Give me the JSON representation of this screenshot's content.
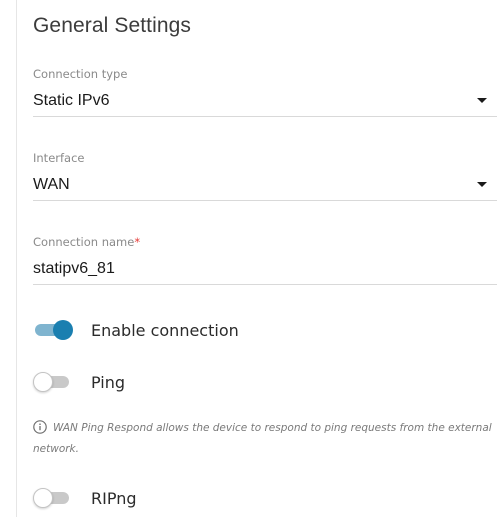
{
  "section": {
    "title": "General Settings"
  },
  "connection_type": {
    "label": "Connection type",
    "value": "Static IPv6"
  },
  "interface": {
    "label": "Interface",
    "value": "WAN"
  },
  "connection_name": {
    "label": "Connection name",
    "required_mark": "*",
    "value": "statipv6_81"
  },
  "toggles": {
    "enable_connection": {
      "label": "Enable connection",
      "state": "on"
    },
    "ping": {
      "label": "Ping",
      "state": "off"
    },
    "ripng": {
      "label": "RIPng",
      "state": "off"
    }
  },
  "ping_hint": {
    "icon": "info-icon",
    "text": "WAN Ping Respond allows the device to respond to ping requests from the external network."
  },
  "colors": {
    "accent": "#1a7fb0",
    "accent_track": "#7fb4cf",
    "required": "#e53935"
  }
}
